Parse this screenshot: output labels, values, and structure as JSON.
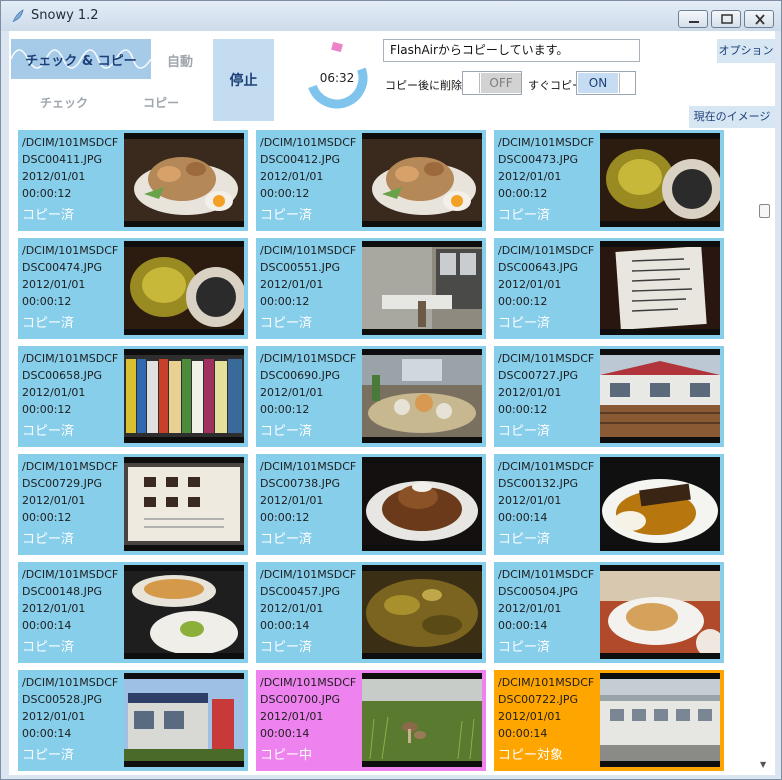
{
  "window": {
    "title": "Snowy 1.2"
  },
  "modes": {
    "check_copy": "チェック & コピー",
    "auto": "自動",
    "check": "チェック",
    "copy": "コピー"
  },
  "controls": {
    "stop_label": "停止",
    "timer": "06:32",
    "status_message": "FlashAirからコピーしています。",
    "option_label": "オプション",
    "delete_after_copy_label": "コピー後に削除",
    "delete_after_copy_value": "OFF",
    "copy_now_label": "すぐコピー",
    "copy_now_value": "ON",
    "current_image_label": "現在のイメージ"
  },
  "colors": {
    "copied": "#87ceeb",
    "copying": "#ee82ee",
    "target": "#ffa500",
    "accent": "#1d3f78"
  },
  "files": [
    {
      "folder": "/DCIM/101MSDCF",
      "name": "DSC00411.JPG",
      "date": "2012/01/01",
      "time": "00:00:12",
      "status": "コピー済",
      "state": "copied",
      "thumb": "food-plate-icon"
    },
    {
      "folder": "/DCIM/101MSDCF",
      "name": "DSC00412.JPG",
      "date": "2012/01/01",
      "time": "00:00:12",
      "status": "コピー済",
      "state": "copied",
      "thumb": "food-plate-icon"
    },
    {
      "folder": "/DCIM/101MSDCF",
      "name": "DSC00473.JPG",
      "date": "2012/01/01",
      "time": "00:00:12",
      "status": "コピー済",
      "state": "copied",
      "thumb": "drink-glass-icon"
    },
    {
      "folder": "/DCIM/101MSDCF",
      "name": "DSC00474.JPG",
      "date": "2012/01/01",
      "time": "00:00:12",
      "status": "コピー済",
      "state": "copied",
      "thumb": "drink-glass-icon"
    },
    {
      "folder": "/DCIM/101MSDCF",
      "name": "DSC00551.JPG",
      "date": "2012/01/01",
      "time": "00:00:12",
      "status": "コピー済",
      "state": "copied",
      "thumb": "room-table-icon"
    },
    {
      "folder": "/DCIM/101MSDCF",
      "name": "DSC00643.JPG",
      "date": "2012/01/01",
      "time": "00:00:12",
      "status": "コピー済",
      "state": "copied",
      "thumb": "menu-paper-icon"
    },
    {
      "folder": "/DCIM/101MSDCF",
      "name": "DSC00658.JPG",
      "date": "2012/01/01",
      "time": "00:00:12",
      "status": "コピー済",
      "state": "copied",
      "thumb": "bookshelf-icon"
    },
    {
      "folder": "/DCIM/101MSDCF",
      "name": "DSC00690.JPG",
      "date": "2012/01/01",
      "time": "00:00:12",
      "status": "コピー済",
      "state": "copied",
      "thumb": "buffet-table-icon"
    },
    {
      "folder": "/DCIM/101MSDCF",
      "name": "DSC00727.JPG",
      "date": "2012/01/01",
      "time": "00:00:12",
      "status": "コピー済",
      "state": "copied",
      "thumb": "building-deck-icon"
    },
    {
      "folder": "/DCIM/101MSDCF",
      "name": "DSC00729.JPG",
      "date": "2012/01/01",
      "time": "00:00:12",
      "status": "コピー済",
      "state": "copied",
      "thumb": "menu-board-icon"
    },
    {
      "folder": "/DCIM/101MSDCF",
      "name": "DSC00738.JPG",
      "date": "2012/01/01",
      "time": "00:00:12",
      "status": "コピー済",
      "state": "copied",
      "thumb": "hamburg-plate-icon"
    },
    {
      "folder": "/DCIM/101MSDCF",
      "name": "DSC00132.JPG",
      "date": "2012/01/01",
      "time": "00:00:14",
      "status": "コピー済",
      "state": "copied",
      "thumb": "curry-plate-icon"
    },
    {
      "folder": "/DCIM/101MSDCF",
      "name": "DSC00148.JPG",
      "date": "2012/01/01",
      "time": "00:00:14",
      "status": "コピー済",
      "state": "copied",
      "thumb": "pizza-plates-icon"
    },
    {
      "folder": "/DCIM/101MSDCF",
      "name": "DSC00457.JPG",
      "date": "2012/01/01",
      "time": "00:00:14",
      "status": "コピー済",
      "state": "copied",
      "thumb": "food-closeup-icon"
    },
    {
      "folder": "/DCIM/101MSDCF",
      "name": "DSC00504.JPG",
      "date": "2012/01/01",
      "time": "00:00:14",
      "status": "コピー済",
      "state": "copied",
      "thumb": "dish-plate-icon"
    },
    {
      "folder": "/DCIM/101MSDCF",
      "name": "DSC00528.JPG",
      "date": "2012/01/01",
      "time": "00:00:14",
      "status": "コピー済",
      "state": "copied",
      "thumb": "storefront-icon"
    },
    {
      "folder": "/DCIM/101MSDCF",
      "name": "DSC00700.JPG",
      "date": "2012/01/01",
      "time": "00:00:14",
      "status": "コピー中",
      "state": "copying",
      "thumb": "mushroom-grass-icon"
    },
    {
      "folder": "/DCIM/101MSDCF",
      "name": "DSC00722.JPG",
      "date": "2012/01/01",
      "time": "00:00:14",
      "status": "コピー対象",
      "state": "target",
      "thumb": "station-building-icon"
    }
  ]
}
